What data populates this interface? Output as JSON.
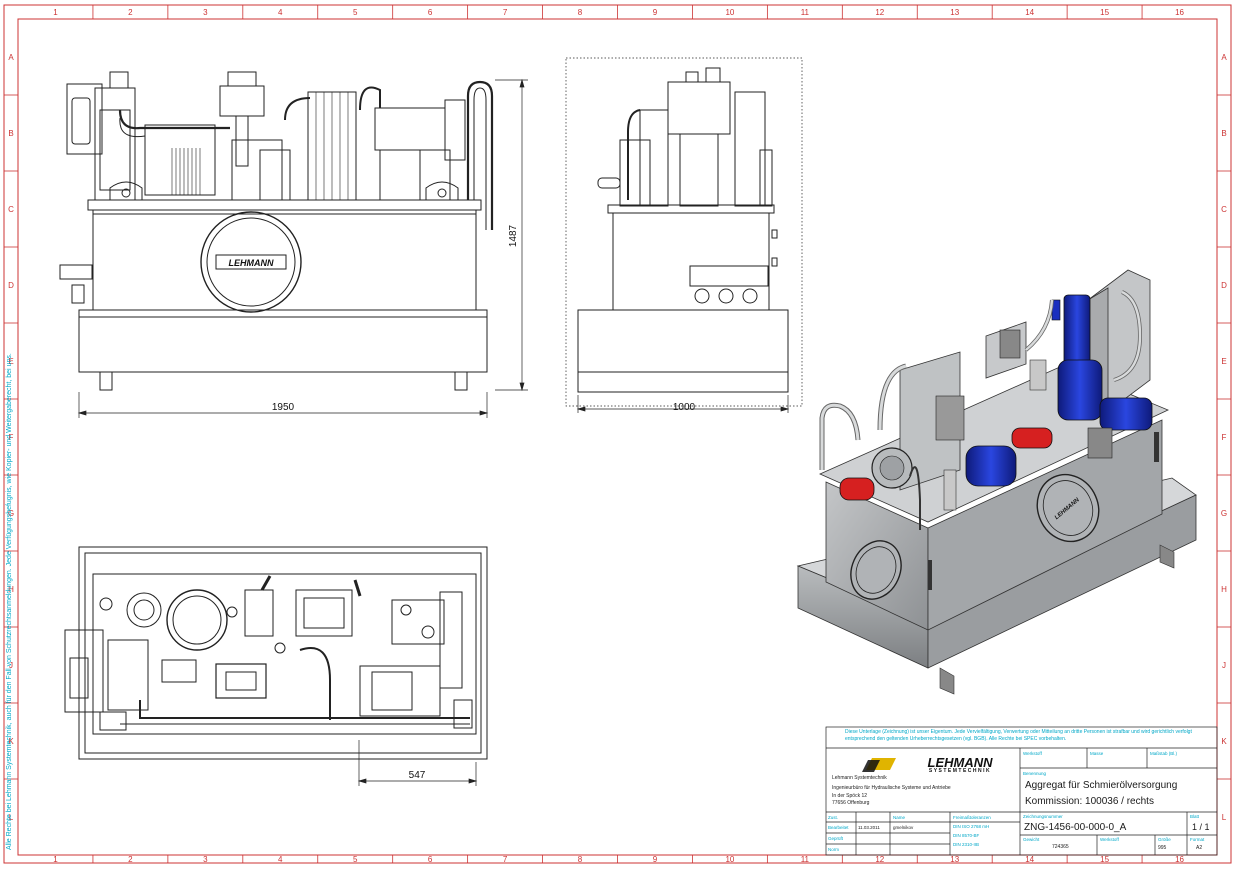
{
  "colors": {
    "frame": "#cc3333",
    "accent": "#00a8c8",
    "line": "#222222",
    "part_red": "#d62020",
    "part_blue": "#1a2fbf",
    "housing": "#a9abad"
  },
  "border": {
    "columns": [
      "1",
      "2",
      "3",
      "4",
      "5",
      "6",
      "7",
      "8",
      "9",
      "10",
      "11",
      "12",
      "13",
      "14",
      "15",
      "16"
    ],
    "rows": [
      "A",
      "B",
      "C",
      "D",
      "E",
      "F",
      "G",
      "H",
      "J",
      "K",
      "L"
    ]
  },
  "side_note": "Alle Rechte bei Lehmann Systemtechnik, auch für den Fall von Schutzrechtsanmeldungen. Jede Verfügungsbefugnis, wie Kopier- und Weitergaberecht, bei uns.",
  "dimensions": {
    "front_width": "1950",
    "height": "1487",
    "side_width": "1000",
    "top_detail": "547"
  },
  "logo": {
    "name": "LEHMANN",
    "tagline": "SYSTEMTECHNIK",
    "front_badge": "LEHMANN"
  },
  "title_block": {
    "disclaimer": "Diese Unterlage (Zeichnung) ist unser Eigentum. Jede Vervielfältigung, Verwertung oder Mitteilung an dritte Personen ist strafbar und wird gerichtlich verfolgt entsprechend den geltenden Urheberrechtsgesetzen (vgl. BGB). Alle Rechte bei SPEC vorbehalten.",
    "company": "Lehmann Systemtechnik",
    "company_desc": "Ingenieurbüro für Hydraulische Systeme und Antriebe",
    "street": "In der Spöck 12",
    "city": "77656 Offenburg",
    "rev_header": "Zust.",
    "date_label": "Bearbeitet",
    "date": "11.03.2011",
    "drawn_by": "gmelnikov",
    "name_header": "Name",
    "checked_label": "Geprüft",
    "norm_label": "Norm",
    "tol_label": "Freimaßtoleranzen",
    "tol_lines": [
      "DIN ISO 2768 mH",
      "DIN 8570-BF",
      "DIN 2310-IIB"
    ],
    "scale_label": "Maßstab (Bl.)",
    "mass_label": "Masse",
    "material_label": "Werkstoff",
    "designation_label": "Benennung",
    "title1": "Aggregat für Schmierölversorgung",
    "title2": "Kommission: 100036 / rechts",
    "drawing_no_label": "Zeichnungsnummer",
    "drawing_no": "ZNG-1456-00-000-0_A",
    "sheet_label": "Blatt",
    "sheet": "1 / 1",
    "weight_label": "Gewicht",
    "weight": "724365",
    "format_label": "Format",
    "format": "A2",
    "size_label": "Größe",
    "size": "995"
  }
}
